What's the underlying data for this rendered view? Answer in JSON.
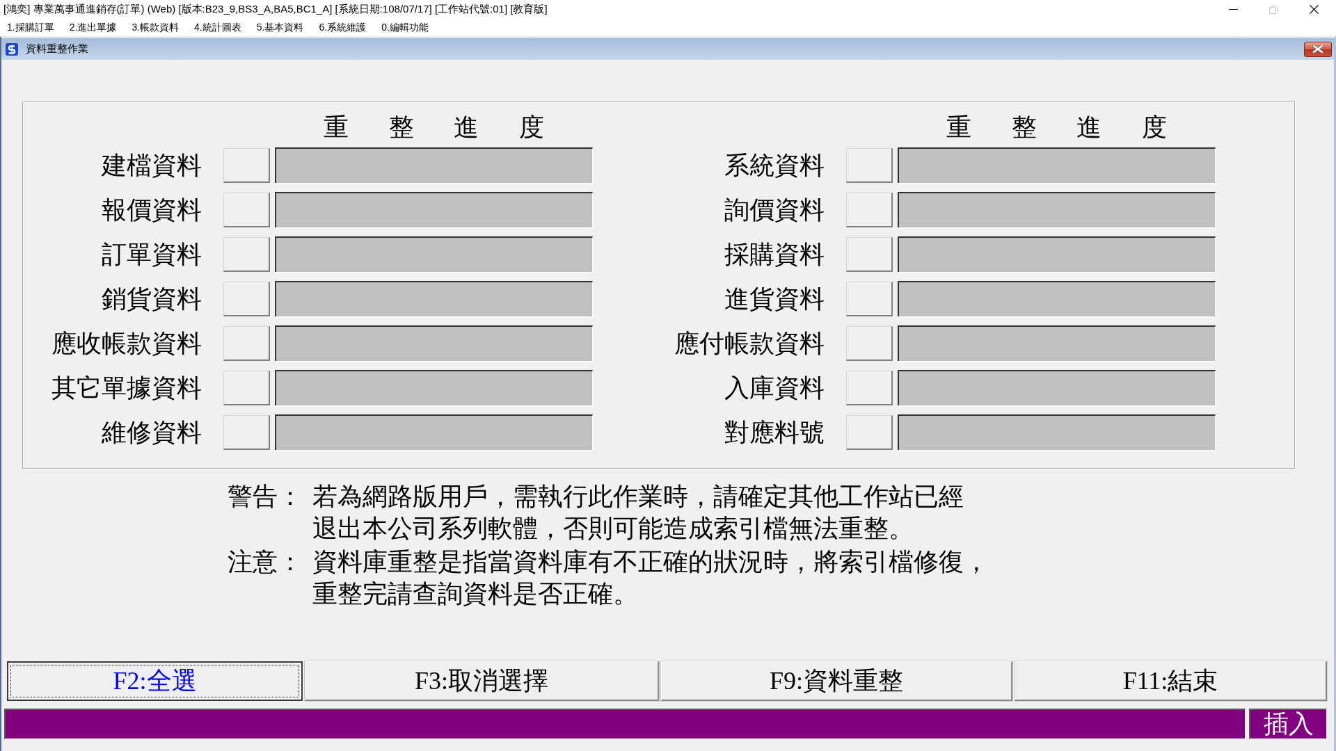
{
  "window": {
    "title": "[鴻奕] 專業萬事通進銷存(訂單) (Web) [版本:B23_9,BS3_A,BA5,BC1_A] [系統日期:108/07/17] [工作站代號:01] [教育版]",
    "controls": [
      {
        "kind": "minimize",
        "disabled": false
      },
      {
        "kind": "restore",
        "disabled": true
      },
      {
        "kind": "close",
        "disabled": false
      }
    ]
  },
  "menu": [
    "1.採購訂單",
    "2.進出單據",
    "3.帳款資料",
    "4.統計圖表",
    "5.基本資料",
    "6.系統維護",
    "0.編輯功能"
  ],
  "dialog": {
    "title": "資料重整作業"
  },
  "rebuild_panel": {
    "columns": [
      {
        "header": "重整進度",
        "items": [
          {
            "label": "建檔資料",
            "checked": false,
            "level": 0
          },
          {
            "label": "報價資料",
            "checked": false,
            "level": 0
          },
          {
            "label": "訂單資料",
            "checked": false,
            "level": 0
          },
          {
            "label": "銷貨資料",
            "checked": false,
            "level": 0
          },
          {
            "label": "應收帳款資料",
            "checked": false,
            "level": 0
          },
          {
            "label": "其它單據資料",
            "checked": false,
            "level": 0
          },
          {
            "label": "維修資料",
            "checked": false,
            "level": 0
          }
        ]
      },
      {
        "header": "重整進度",
        "items": [
          {
            "label": "系統資料",
            "checked": false,
            "level": 0
          },
          {
            "label": "詢價資料",
            "checked": false,
            "level": 0
          },
          {
            "label": "採購資料",
            "checked": false,
            "level": 0
          },
          {
            "label": "進貨資料",
            "checked": false,
            "level": 0
          },
          {
            "label": "應付帳款資料",
            "checked": false,
            "level": 0
          },
          {
            "label": "入庫資料",
            "checked": false,
            "level": 0
          },
          {
            "label": "對應料號",
            "checked": false,
            "level": 0
          }
        ]
      }
    ]
  },
  "notes": [
    {
      "label": "警告：",
      "lines": [
        "若為網路版用戶，需執行此作業時，請確定其他工作站已經",
        "退出本公司系列軟體，否則可能造成索引檔無法重整。"
      ]
    },
    {
      "label": "注意：",
      "lines": [
        "資料庫重整是指當資料庫有不正確的狀況時，將索引檔修復，",
        "重整完請查詢資料是否正確。"
      ]
    }
  ],
  "buttons": [
    {
      "label": "F2:全選",
      "focused": true
    },
    {
      "label": "F3:取消選擇",
      "focused": false
    },
    {
      "label": "F9:資料重整",
      "focused": false
    },
    {
      "label": "F11:結束",
      "focused": false
    }
  ],
  "status_bar": {
    "mode": "插入"
  }
}
